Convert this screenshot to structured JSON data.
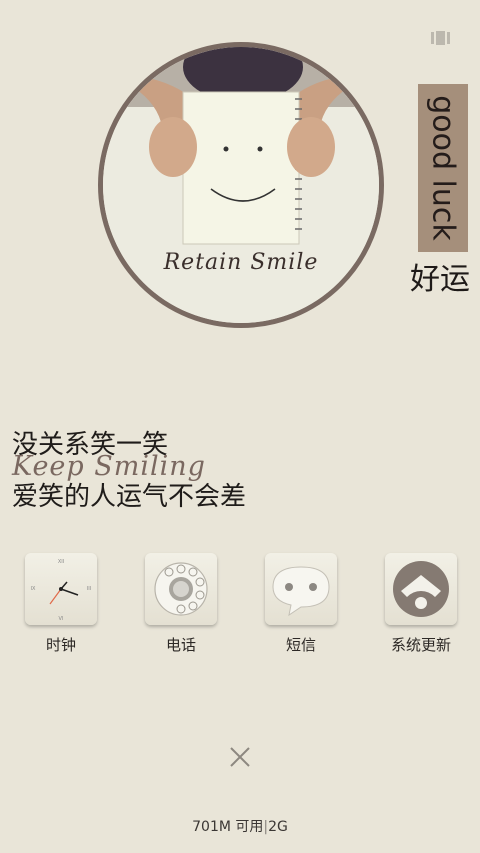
{
  "hero": {
    "caption": "Retain Smile"
  },
  "tag": {
    "text": "good luck"
  },
  "fortune_text": "好运",
  "text_block": {
    "line1": "没关系笑一笑",
    "line2": "Keep Smiling",
    "line3": "爱笑的人运气不会差"
  },
  "dock": {
    "apps": [
      {
        "label": "时钟",
        "icon": "clock-icon"
      },
      {
        "label": "电话",
        "icon": "rotary-phone-icon"
      },
      {
        "label": "短信",
        "icon": "chat-bubble-icon"
      },
      {
        "label": "系统更新",
        "icon": "update-heart-icon"
      }
    ]
  },
  "footer": {
    "close_icon": "close-icon",
    "memory_available": "701M 可用",
    "network": "2G"
  },
  "colors": {
    "background": "#e9e5d8",
    "tag": "#a58f7b",
    "circle_border": "#7a6a62"
  }
}
